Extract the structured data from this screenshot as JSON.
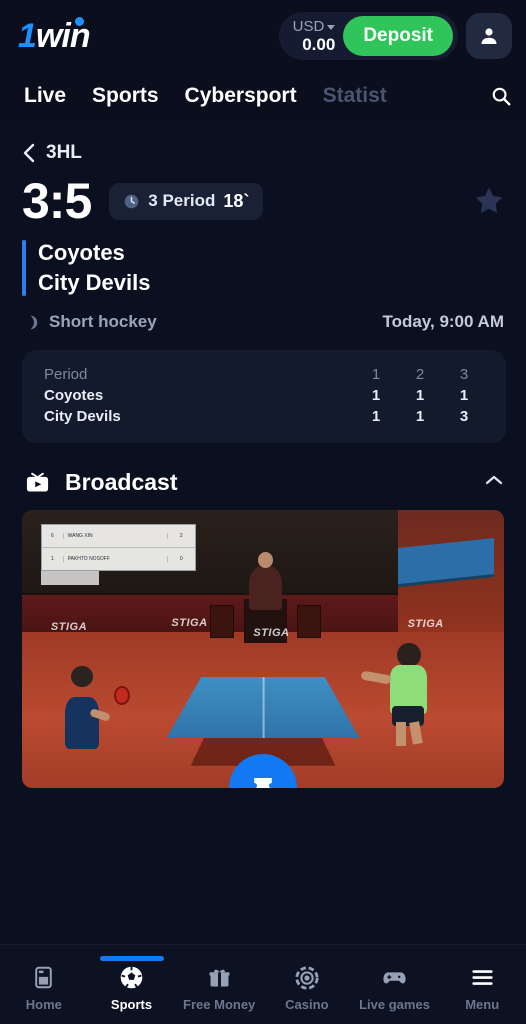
{
  "brand": {
    "logo_one": "1",
    "logo_win": "win"
  },
  "topbar": {
    "currency": "USD",
    "balance": "0.00",
    "deposit_label": "Deposit",
    "currency_icon": "chevron-down-icon",
    "avatar_icon": "user-avatar-icon"
  },
  "nav": {
    "items": [
      {
        "label": "Live",
        "faded": false
      },
      {
        "label": "Sports",
        "faded": false
      },
      {
        "label": "Cybersport",
        "faded": false
      },
      {
        "label": "Statist",
        "faded": true
      }
    ],
    "search_icon": "search-icon"
  },
  "breadcrumb": {
    "back_icon": "chevron-left-icon",
    "label": "3HL"
  },
  "match": {
    "score": "3:5",
    "period_icon": "clock-icon",
    "period_label": "3 Period",
    "period_time": "18`",
    "favorite_icon": "star-icon",
    "team_home": "Coyotes",
    "team_away": "City Devils",
    "sport_icon": "hockey-puck-icon",
    "sport_label": "Short hockey",
    "datetime": "Today, 9:00 AM"
  },
  "period_table": {
    "row_label_header": "Period",
    "columns": [
      "1",
      "2",
      "3"
    ],
    "rows": [
      {
        "team": "Coyotes",
        "scores": [
          "1",
          "1",
          "1"
        ]
      },
      {
        "team": "City Devils",
        "scores": [
          "1",
          "1",
          "3"
        ]
      }
    ]
  },
  "broadcast": {
    "icon": "broadcast-tv-icon",
    "title": "Broadcast",
    "collapse_icon": "chevron-up-icon",
    "video": {
      "overlay_rows": [
        {
          "seed": "6",
          "name": "WANG XIN",
          "score": "2"
        },
        {
          "seed": "1",
          "name": "PAKHTO NOSOFF",
          "score": "0"
        }
      ],
      "branding": "STIGA"
    },
    "betslip_fab_icon": "betslip-ticket-icon"
  },
  "bottom_nav": {
    "items": [
      {
        "label": "Home",
        "icon": "home-screen-icon",
        "active": false
      },
      {
        "label": "Sports",
        "icon": "soccer-ball-icon",
        "active": true
      },
      {
        "label": "Free Money",
        "icon": "gift-box-icon",
        "active": false
      },
      {
        "label": "Casino",
        "icon": "casino-chip-icon",
        "active": false
      },
      {
        "label": "Live games",
        "icon": "gamepad-icon",
        "active": false
      },
      {
        "label": "Menu",
        "icon": "hamburger-menu-icon",
        "active": false
      }
    ]
  },
  "colors": {
    "background": "#0b1021",
    "accent_blue": "#1279f2",
    "deposit_green": "#2fc55b",
    "card": "#131a2c"
  }
}
